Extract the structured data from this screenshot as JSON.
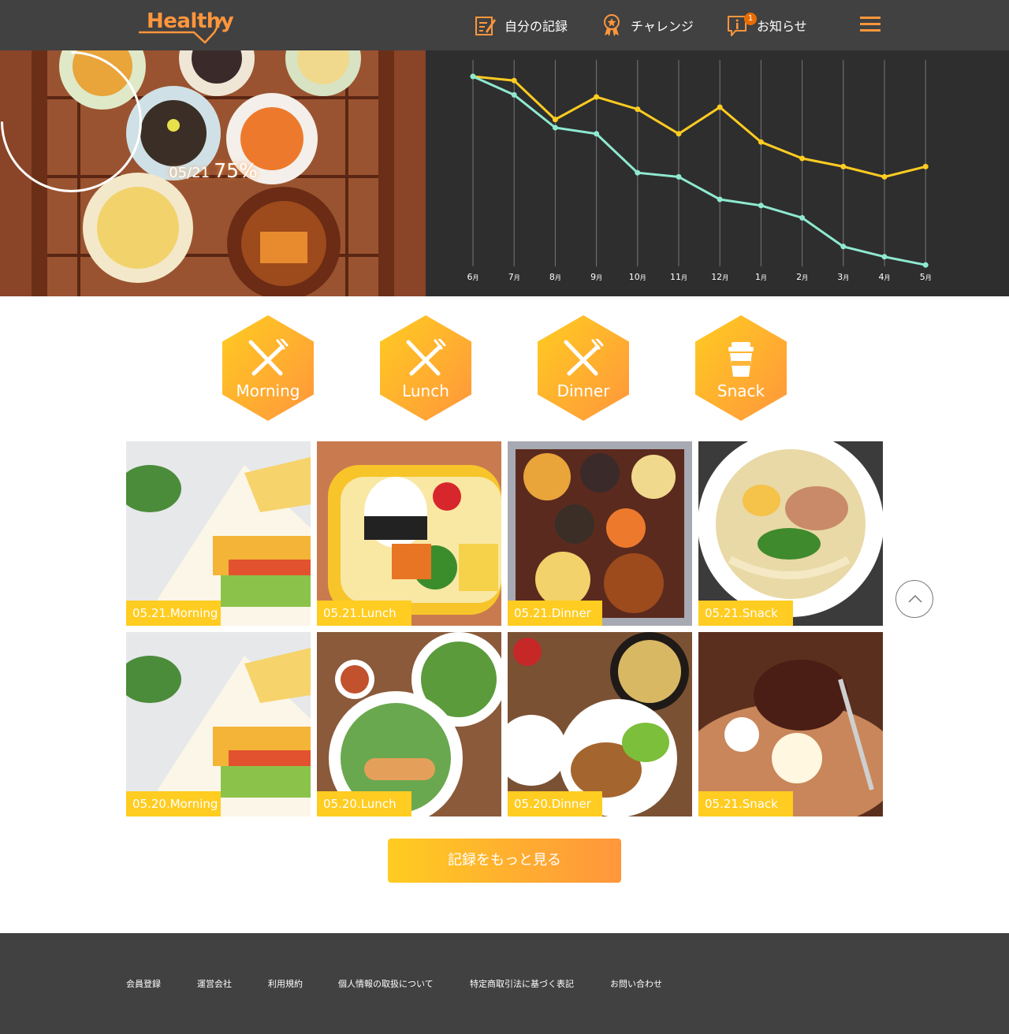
{
  "header": {
    "logo": "Healthy",
    "nav": [
      {
        "label": "自分の記録",
        "icon": "memo-icon"
      },
      {
        "label": "チャレンジ",
        "icon": "challenge-medal-icon"
      },
      {
        "label": "お知らせ",
        "icon": "info-icon",
        "badge": "1"
      }
    ],
    "menu_icon": "hamburger-icon"
  },
  "hero": {
    "date": "05/21",
    "achievement": "75%",
    "achievement_value": 0.75
  },
  "chart_data": {
    "type": "line",
    "categories": [
      "6",
      "7",
      "8",
      "9",
      "10",
      "11",
      "12",
      "1",
      "2",
      "3",
      "4",
      "5"
    ],
    "unit": "月",
    "series": [
      {
        "color": "#ffcc21",
        "values": [
          95,
          93,
          74,
          85,
          79,
          67,
          80,
          63,
          55,
          51,
          46,
          51
        ]
      },
      {
        "color": "#8fe9d0",
        "values": [
          95,
          86,
          70,
          67,
          48,
          46,
          35,
          32,
          26,
          12,
          7,
          3
        ]
      }
    ],
    "ylim": [
      0,
      100
    ],
    "grid": true
  },
  "meal_buttons": [
    {
      "label": "Morning",
      "icon": "knife-fork-icon"
    },
    {
      "label": "Lunch",
      "icon": "knife-fork-icon"
    },
    {
      "label": "Dinner",
      "icon": "knife-fork-icon"
    },
    {
      "label": "Snack",
      "icon": "cup-icon"
    }
  ],
  "records": [
    {
      "label": "05.21.Morning"
    },
    {
      "label": "05.21.Lunch"
    },
    {
      "label": "05.21.Dinner"
    },
    {
      "label": "05.21.Snack"
    },
    {
      "label": "05.20.Morning"
    },
    {
      "label": "05.20.Lunch"
    },
    {
      "label": "05.20.Dinner"
    },
    {
      "label": "05.21.Snack"
    }
  ],
  "more_button": "記録をもっと見る",
  "scroll_top_icon": "chevron-up-icon",
  "footer": {
    "links": [
      "会員登録",
      "運営会社",
      "利用規約",
      "個人情報の取扱について",
      "特定商取引法に基づく表記",
      "お問い合わせ"
    ]
  },
  "colors": {
    "primary": "#ff963c",
    "accent": "#ffcc21",
    "secondary": "#8fe9d0",
    "dark": "#414141",
    "dark_chart": "#2e2e2e"
  }
}
